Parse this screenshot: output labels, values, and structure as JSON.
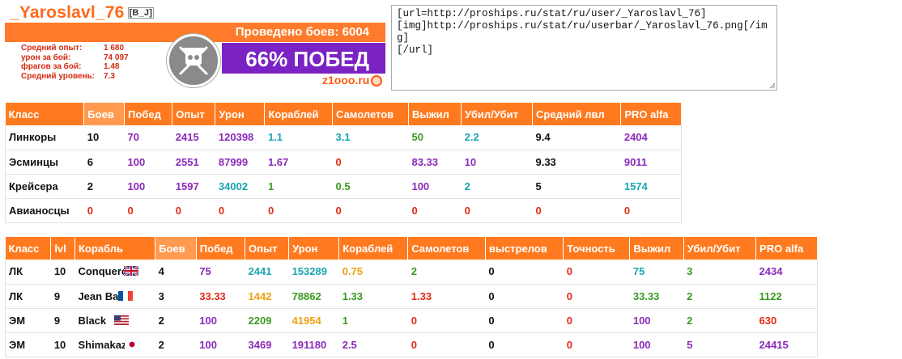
{
  "userbar": {
    "name": "_Yaroslavl_76",
    "clan": "[B_J]",
    "battles": "Проведено боев: 6004",
    "wins": "66% ПОБЕД",
    "site": "z1ooo.ru",
    "stats": [
      {
        "label": "Средний опыт:",
        "value": "1 680"
      },
      {
        "label": "урон за бой:",
        "value": "74 097"
      },
      {
        "label": "фрагов за бой:",
        "value": "1.48"
      },
      {
        "label": "Средний уровень:",
        "value": "7.3"
      }
    ],
    "colors": {
      "orange": "#ff7a2a",
      "purple": "#7b22c4",
      "stat_red": "#d62a10"
    }
  },
  "code": "[url=http://proships.ru/stat/ru/user/_Yaroslavl_76]\n[img]http://proships.ru/stat/ru/userbar/_Yaroslavl_76.png[/img]\n[/url]",
  "class_table": {
    "headers": [
      "Класс",
      "Боев",
      "Побед",
      "Опыт",
      "Урон",
      "Кораблей",
      "Самолетов",
      "Выжил",
      "Убил/Убит",
      "Средний лвл",
      "PRO alfa"
    ],
    "rows": [
      [
        "Линкоры",
        "10",
        "70",
        "2415",
        "120398",
        "1.1",
        "3.1",
        "50",
        "2.2",
        "9.4",
        "2404"
      ],
      [
        "Эсминцы",
        "6",
        "100",
        "2551",
        "87999",
        "1.67",
        "0",
        "83.33",
        "10",
        "9.33",
        "9011"
      ],
      [
        "Крейсера",
        "2",
        "100",
        "1597",
        "34002",
        "1",
        "0.5",
        "100",
        "2",
        "5",
        "1574"
      ],
      [
        "Авианосцы",
        "0",
        "0",
        "0",
        "0",
        "0",
        "0",
        "0",
        "0",
        "0",
        "0"
      ]
    ]
  },
  "ship_table": {
    "headers": [
      "Класс",
      "lvl",
      "Корабль",
      "Боев",
      "Побед",
      "Опыт",
      "Урон",
      "Кораблей",
      "Самолетов",
      "выстрелов",
      "Точность",
      "Выжил",
      "Убил/Убит",
      "PRO alfa"
    ],
    "rows": [
      [
        "ЛК",
        "10",
        "Conqueror",
        "4",
        "75",
        "2441",
        "153289",
        "0.75",
        "2",
        "0",
        "0",
        "75",
        "3",
        "2434"
      ],
      [
        "ЛК",
        "9",
        "Jean Bart",
        "3",
        "33.33",
        "1442",
        "78862",
        "1.33",
        "1.33",
        "0",
        "0",
        "33.33",
        "2",
        "1122"
      ],
      [
        "ЭМ",
        "9",
        "Black",
        "2",
        "100",
        "2209",
        "41954",
        "1",
        "0",
        "0",
        "0",
        "100",
        "2",
        "630"
      ],
      [
        "ЭМ",
        "10",
        "Shimakaze",
        "2",
        "100",
        "3469",
        "191180",
        "2.5",
        "0",
        "0",
        "0",
        "100",
        "5",
        "24415"
      ]
    ],
    "flags": [
      "uk-flag",
      "france-flag",
      "usa-flag",
      "japan-flag"
    ]
  }
}
